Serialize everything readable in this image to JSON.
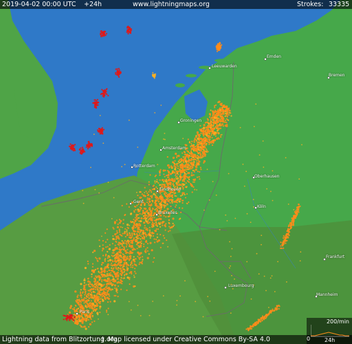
{
  "header": {
    "datetime": "2019-04-02 00:00 UTC",
    "window": "+24h",
    "site": "www.lightningmaps.org",
    "strokes_label": "Strokes:",
    "strokes_count": "33335"
  },
  "footer": {
    "attribution": "Lightning data from Blitzortung.org",
    "license": "Map licensed under Creative Commons By-SA 4.0"
  },
  "rate_graph": {
    "scale": "200/min",
    "min": "0",
    "span": "24h"
  },
  "cities": [
    {
      "name": "Emden"
    },
    {
      "name": "Leeuwarden"
    },
    {
      "name": "Bremen"
    },
    {
      "name": "Groningen"
    },
    {
      "name": "Amsterdam"
    },
    {
      "name": "Rotterdam"
    },
    {
      "name": "Oberhausen"
    },
    {
      "name": "Eindhoven"
    },
    {
      "name": "Köln"
    },
    {
      "name": "Gent"
    },
    {
      "name": "Bruxelles"
    },
    {
      "name": "Frankfurt"
    },
    {
      "name": "Luxembourg"
    },
    {
      "name": "Mannheim"
    },
    {
      "name": "Paris"
    }
  ],
  "colors": {
    "sea": "#2f79c8",
    "land_nl_de": "#42a246",
    "land_south": "#5b9c43",
    "strike_recent": "#ff8c1a",
    "strike_old": "#e01818",
    "strike_mid": "#ffb020",
    "border": "#6a6a6a",
    "text": "#ffffff"
  }
}
